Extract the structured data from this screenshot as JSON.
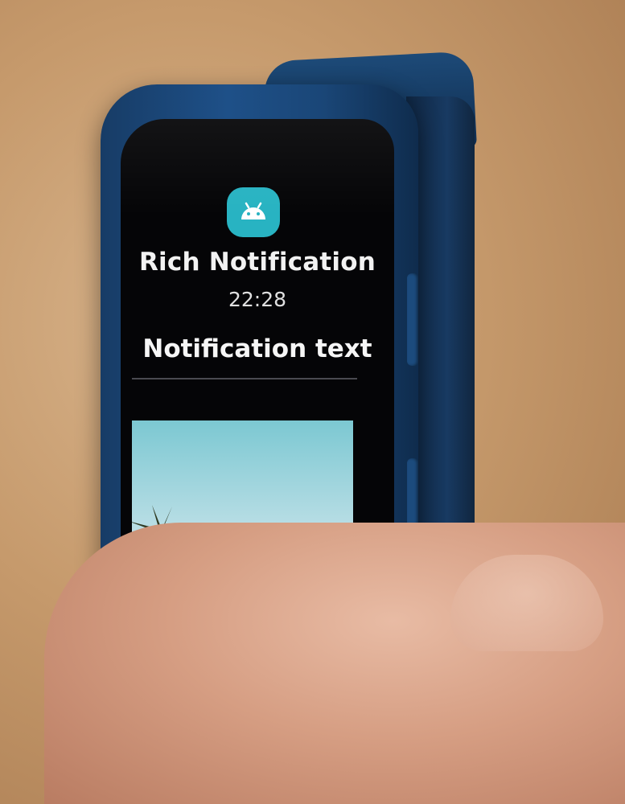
{
  "notification": {
    "app_icon": "android-icon",
    "app_icon_color": "#28b3c2",
    "title": "Rich Notification",
    "time": "22:28",
    "text": "Notification text",
    "image": "palm-trees-photo"
  },
  "device": {
    "band_color": "#1e5088",
    "screen_color": "#050507"
  }
}
